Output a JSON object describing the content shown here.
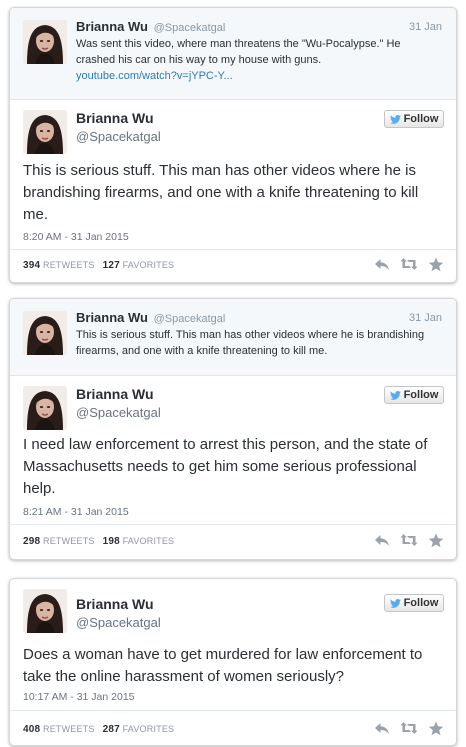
{
  "colors": {
    "link": "#2b7bb9",
    "twitter_blue": "#55acee",
    "muted": "#8899a6",
    "text": "#292f33"
  },
  "icons": {
    "follow": "twitter-bird-icon",
    "reply": "reply-icon",
    "retweet": "retweet-icon",
    "favorite": "star-icon"
  },
  "cards": [
    {
      "quoted": {
        "name": "Brianna Wu",
        "handle": "@Spacekatgal",
        "date": "31 Jan",
        "text": "Was sent this video, where man threatens the \"Wu-Pocalypse.\" He crashed his car on his way to my house with guns.",
        "link": "youtube.com/watch?v=jYPC-Y..."
      },
      "tweet": {
        "name": "Brianna Wu",
        "handle": "@Spacekatgal",
        "follow_label": "Follow",
        "text": "This is serious stuff. This man has other videos where he is brandishing firearms, and one with a knife threatening to kill me.",
        "timestamp": "8:20 AM - 31 Jan 2015",
        "retweets": "394",
        "retweets_label": "RETWEETS",
        "favorites": "127",
        "favorites_label": "FAVORITES"
      }
    },
    {
      "quoted": {
        "name": "Brianna Wu",
        "handle": "@Spacekatgal",
        "date": "31 Jan",
        "text": "This is serious stuff. This man has other videos where he is brandishing firearms, and one with a knife threatening to kill me."
      },
      "tweet": {
        "name": "Brianna Wu",
        "handle": "@Spacekatgal",
        "follow_label": "Follow",
        "text": "I need law enforcement to arrest this person, and the state of Massachusetts needs to get him some serious professional help.",
        "timestamp": "8:21 AM - 31 Jan 2015",
        "retweets": "298",
        "retweets_label": "RETWEETS",
        "favorites": "198",
        "favorites_label": "FAVORITES"
      }
    },
    {
      "tweet": {
        "name": "Brianna Wu",
        "handle": "@Spacekatgal",
        "follow_label": "Follow",
        "text": "Does a woman have to get murdered for law enforcement to take the online harassment of women seriously?",
        "timestamp": "10:17 AM - 31 Jan 2015",
        "retweets": "408",
        "retweets_label": "RETWEETS",
        "favorites": "287",
        "favorites_label": "FAVORITES"
      }
    }
  ]
}
